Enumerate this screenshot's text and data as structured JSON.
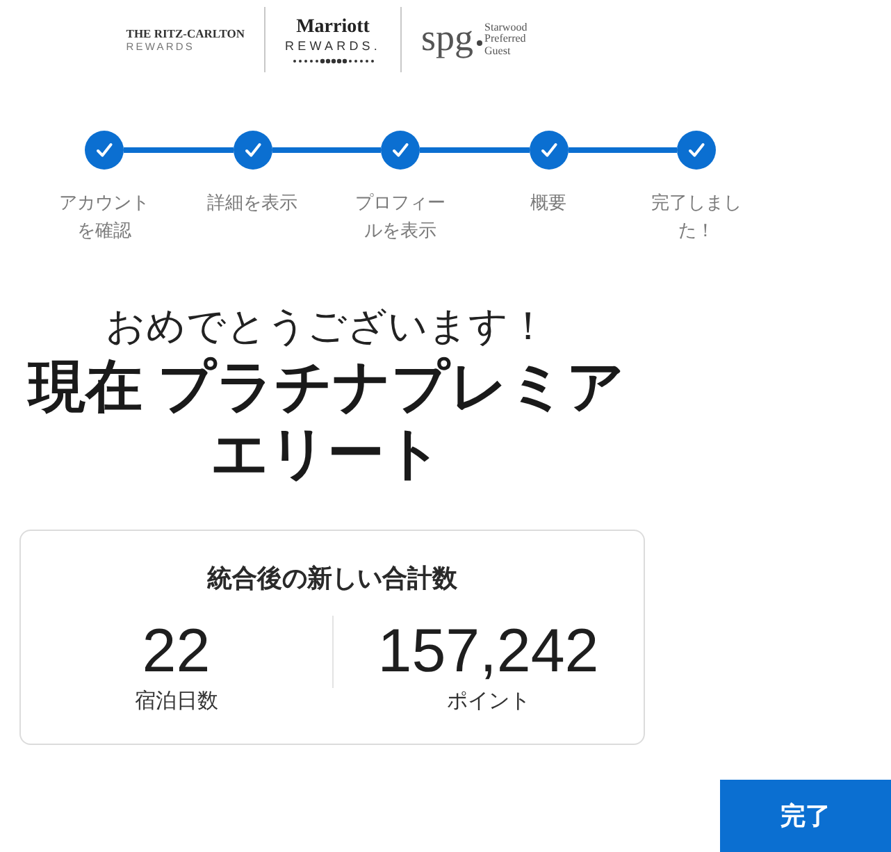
{
  "logos": [
    {
      "kind": "ritz",
      "title": "THE RITZ-CARLTON",
      "subtitle": "REWARDS"
    },
    {
      "kind": "marriott",
      "title": "Marriott",
      "subtitle": "REWARDS."
    },
    {
      "kind": "spg",
      "title": "spg",
      "subtitle": "Starwood Preferred Guest"
    }
  ],
  "steps": [
    {
      "label": "アカウントを確認",
      "completed": true
    },
    {
      "label": "詳細を表示",
      "completed": true
    },
    {
      "label": "プロフィールを表示",
      "completed": true
    },
    {
      "label": "概要",
      "completed": true
    },
    {
      "label": "完了しました！",
      "completed": true
    }
  ],
  "heading": {
    "greeting": "おめでとうございます！",
    "status": "現在 プラチナプレミアエリート"
  },
  "summary": {
    "title": "統合後の新しい合計数",
    "stats": [
      {
        "value": "22",
        "label": "宿泊日数"
      },
      {
        "value": "157,242",
        "label": "ポイント"
      }
    ]
  },
  "done_button": "完了"
}
